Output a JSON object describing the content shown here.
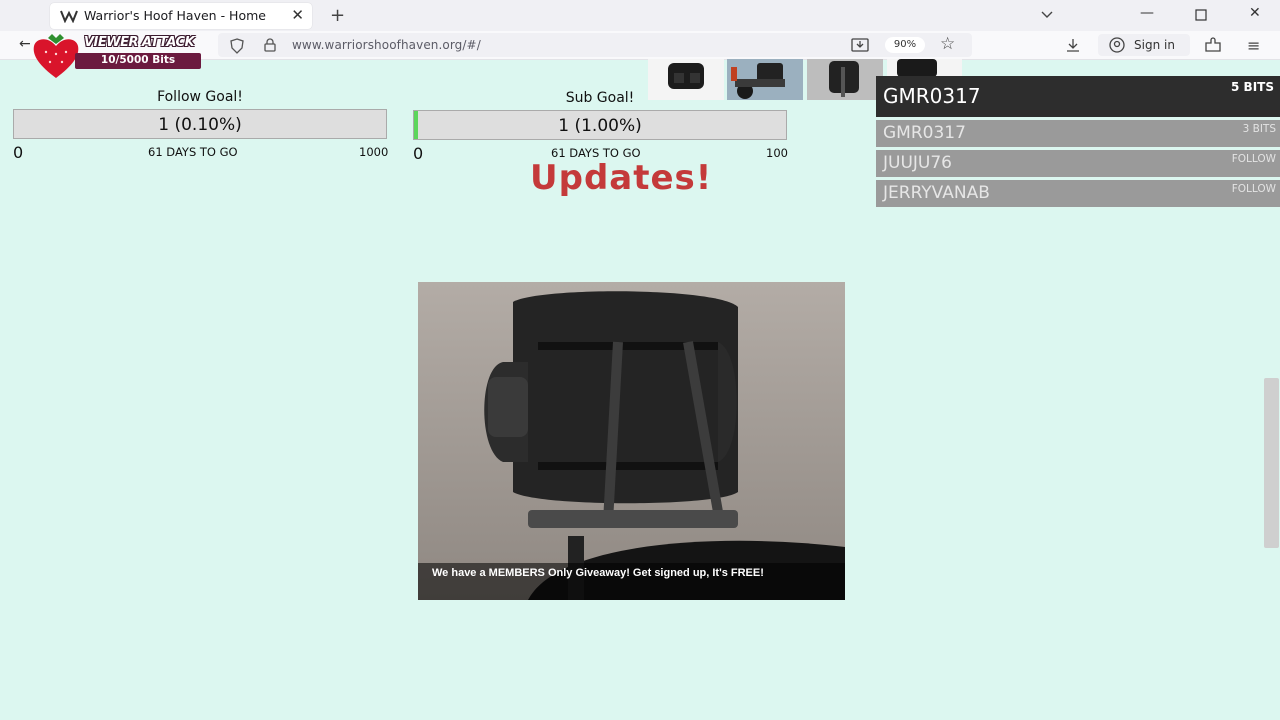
{
  "browser": {
    "tab_title": "Warrior's Hoof Haven - Home",
    "new_tab_icon": "+",
    "url": "www.warriorshoofhaven.org/#/",
    "zoom": "90%",
    "sign_in": "Sign in"
  },
  "viewer_attack": {
    "title": "VIEWER ATTACK",
    "count": "10/5000 Bits"
  },
  "follow_goal": {
    "title": "Follow Goal!",
    "progress": "1 (0.10%)",
    "fraction": 0.001,
    "min": "0",
    "days": "61 DAYS TO GO",
    "max": "1000"
  },
  "sub_goal": {
    "title": "Sub Goal!",
    "progress": "1 (1.00%)",
    "fraction": 0.01,
    "min": "0",
    "days": "61 DAYS TO GO",
    "max": "100"
  },
  "updates_heading": "Updates!",
  "events": {
    "top": {
      "name": "GMR0317",
      "amount": "5 BITS"
    },
    "list": [
      {
        "name": "GMR0317",
        "tag": "3 BITS"
      },
      {
        "name": "JUUJU76",
        "tag": "FOLLOW"
      },
      {
        "name": "JERRYVANAB",
        "tag": "FOLLOW"
      }
    ]
  },
  "card": {
    "caption": "We have a MEMBERS Only Giveaway! Get signed up, It's FREE!"
  },
  "colors": {
    "page_bg": "#dcf7f0",
    "updates_red": "#c43a3a",
    "goal_fill": "#5cd65c",
    "badge_maroon": "#6b1a3f"
  }
}
